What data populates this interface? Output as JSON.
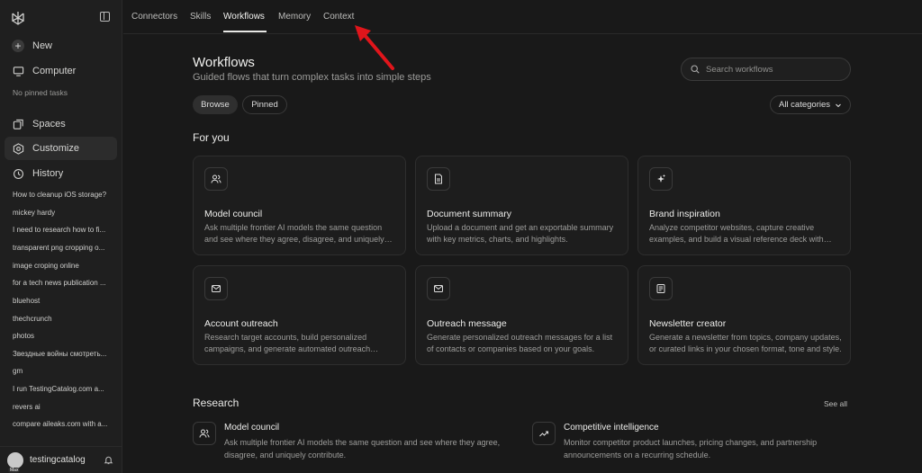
{
  "sidebar": {
    "new_label": "New",
    "computer_label": "Computer",
    "no_pinned": "No pinned tasks",
    "spaces_label": "Spaces",
    "customize_label": "Customize",
    "history_label": "History",
    "history": [
      "How to cleanup iOS storage?",
      "mickey hardy",
      "I need to research how to fi...",
      "transparent png cropping o...",
      "image croping online",
      "for a tech news publication ...",
      "bluehost",
      "thechcrunch",
      "photos",
      "Звездные войны смотреть...",
      "gm",
      "I run TestingCatalog.com a...",
      "revers ai",
      "compare aileaks.com with a..."
    ],
    "user": {
      "name": "testingcatalog",
      "badge": "Max"
    }
  },
  "topnav": {
    "tabs": [
      "Connectors",
      "Skills",
      "Workflows",
      "Memory",
      "Context"
    ],
    "active": "Workflows"
  },
  "main": {
    "title": "Workflows",
    "subtitle": "Guided flows that turn complex tasks into simple steps",
    "search_placeholder": "Search workflows",
    "chips": [
      "Browse",
      "Pinned"
    ],
    "category_dropdown": "All categories",
    "for_you_title": "For you",
    "cards": [
      {
        "icon": "users-icon",
        "title": "Model council",
        "desc": "Ask multiple frontier AI models the same question and see where they agree, disagree, and uniquely contribute."
      },
      {
        "icon": "document-icon",
        "title": "Document summary",
        "desc": "Upload a document and get an exportable summary with key metrics, charts, and highlights."
      },
      {
        "icon": "sparkle-icon",
        "title": "Brand inspiration",
        "desc": "Analyze competitor websites, capture creative examples, and build a visual reference deck with insights."
      },
      {
        "icon": "mail-icon",
        "title": "Account outreach",
        "desc": "Research target accounts, build personalized campaigns, and generate automated outreach sequences."
      },
      {
        "icon": "mail-icon",
        "title": "Outreach message",
        "desc": "Generate personalized outreach messages for a list of contacts or companies based on your goals."
      },
      {
        "icon": "newspaper-icon",
        "title": "Newsletter creator",
        "desc": "Generate a newsletter from topics, company updates, or curated links in your chosen format, tone and style."
      }
    ],
    "research_title": "Research",
    "see_all": "See all",
    "research": [
      {
        "icon": "users-icon",
        "title": "Model council",
        "desc": "Ask multiple frontier AI models the same question and see where they agree, disagree, and uniquely contribute."
      },
      {
        "icon": "trend-up-icon",
        "title": "Competitive intelligence",
        "desc": "Monitor competitor product launches, pricing changes, and partnership announcements on a recurring schedule."
      }
    ]
  },
  "colors": {
    "background": "#191919",
    "sidebar": "#1f1f1f",
    "annotation_arrow": "#e0151b"
  }
}
